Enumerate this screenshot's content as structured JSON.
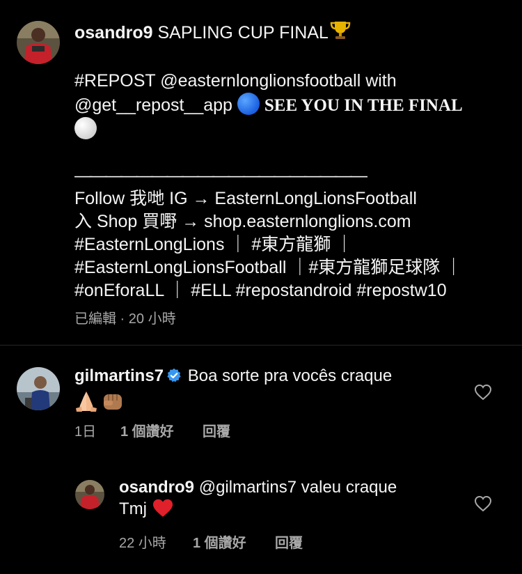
{
  "post": {
    "username": "osandro9",
    "title_text": "SAPLING CUP FINAL",
    "repost_line": "#REPOST @easternlonglionsfootball with",
    "repost_app": "@get__repost__app",
    "final_text": "SEE YOU IN THE FINAL",
    "separator": "———————————————————",
    "follow_line": "Follow 我哋 IG →  EasternLongLionsFootball",
    "shop_line": "入 Shop 買嘢 → shop.easternlonglions.com",
    "tags_1": "#EasternLongLions ｜ #東方龍獅 ｜",
    "tags_2": "#EasternLongLionsFootball ｜#東方龍獅足球隊 ｜",
    "tags_3": "#onEforaLL ｜ #ELL #repostandroid #repostw10",
    "meta": "已編輯 · 20 小時"
  },
  "comments": [
    {
      "username": "gilmartins7",
      "text": "Boa sorte pra vocês craque",
      "time": "1日",
      "likes": "1 個讚好",
      "reply": "回覆"
    },
    {
      "username": "osandro9",
      "mention": "@gilmartins7",
      "text": "valeu craque",
      "text2": "Tmj",
      "time": "22 小時",
      "likes": "1 個讚好",
      "reply": "回覆"
    }
  ],
  "icons": {
    "trophy": "trophy-icon",
    "blue_circle": "blue-circle-icon",
    "white_circle": "white-circle-icon",
    "verified": "verified-badge-icon",
    "heart": "heart-outline-icon",
    "red_heart": "red-heart-icon",
    "folded_hands": "folded-hands-icon",
    "fist": "fist-icon"
  },
  "colors": {
    "background": "#000000",
    "text": "#f5f5f5",
    "secondary": "#a8a8a8",
    "verified": "#3897f0",
    "red_heart": "#e0202a"
  }
}
